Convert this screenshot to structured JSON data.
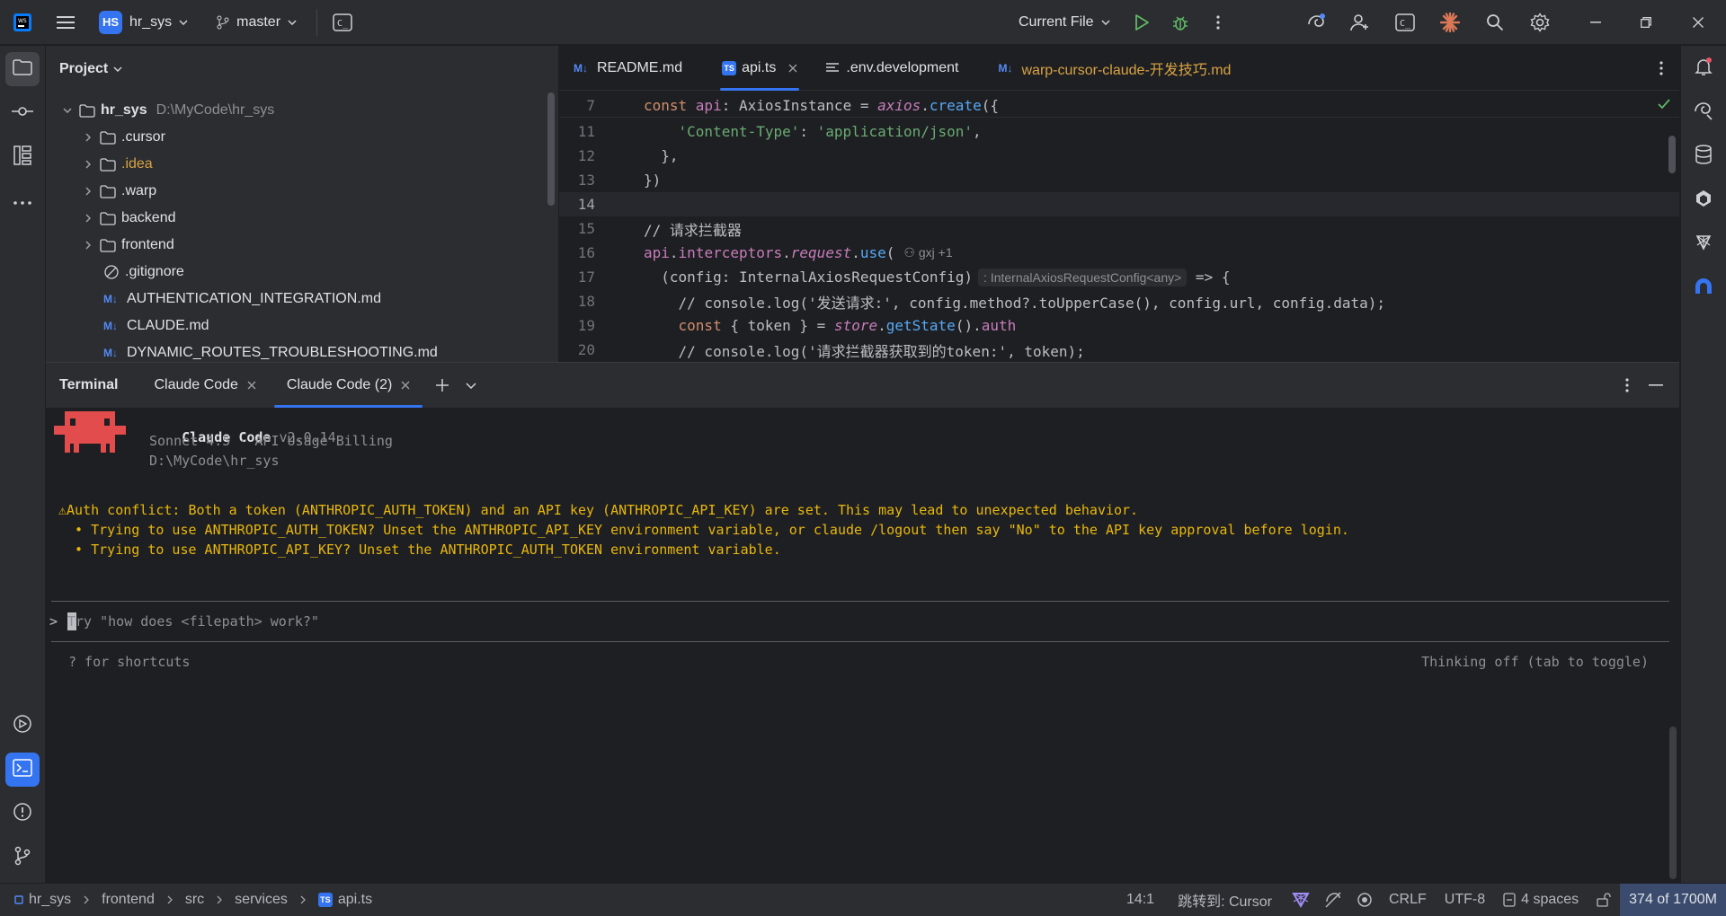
{
  "titlebar": {
    "project_badge": "HS",
    "project_name": "hr_sys",
    "branch": "master",
    "run_config": "Current File",
    "icons": [
      "app-logo-icon",
      "main-menu-icon",
      "branch-icon",
      "terminal-tool-icon",
      "run-icon",
      "debug-icon",
      "more-vert-icon",
      "ai-assistant-icon",
      "add-user-icon",
      "code-with-me-icon",
      "claude-icon",
      "search-icon",
      "settings-icon",
      "minimize-icon",
      "restore-icon",
      "close-icon"
    ]
  },
  "project_panel": {
    "title": "Project",
    "root": {
      "name": "hr_sys",
      "path": "D:\\MyCode\\hr_sys"
    },
    "items": [
      {
        "label": ".cursor",
        "type": "folder"
      },
      {
        "label": ".idea",
        "type": "folder",
        "color": "#d9a343"
      },
      {
        "label": ".warp",
        "type": "folder"
      },
      {
        "label": "backend",
        "type": "folder"
      },
      {
        "label": "frontend",
        "type": "folder"
      },
      {
        "label": ".gitignore",
        "type": "ignore"
      },
      {
        "label": "AUTHENTICATION_INTEGRATION.md",
        "type": "md"
      },
      {
        "label": "CLAUDE.md",
        "type": "md"
      },
      {
        "label": "DYNAMIC_ROUTES_TROUBLESHOOTING.md",
        "type": "md"
      }
    ]
  },
  "editor": {
    "tabs": [
      {
        "label": "README.md",
        "type": "md"
      },
      {
        "label": "api.ts",
        "type": "ts",
        "active": true
      },
      {
        "label": ".env.development",
        "type": "env"
      },
      {
        "label": "warp-cursor-claude-开发技巧.md",
        "type": "md",
        "color": "#d9a343"
      }
    ],
    "line_numbers": [
      "7",
      "11",
      "12",
      "13",
      "14",
      "15",
      "16",
      "17",
      "18",
      "19",
      "20"
    ],
    "code": {
      "l7_a": "const ",
      "l7_b": "api",
      "l7_c": ": AxiosInstance = ",
      "l7_d": "axios",
      "l7_e": ".",
      "l7_f": "create",
      "l7_g": "({",
      "l11_a": "    ",
      "l11_b": "'Content-Type'",
      "l11_c": ": ",
      "l11_d": "'application/json'",
      "l11_e": ",",
      "l12": "  },",
      "l13": "})",
      "l15": "// 请求拦截器",
      "l16_a": "api",
      "l16_b": ".",
      "l16_c": "interceptors",
      "l16_d": ".",
      "l16_e": "request",
      "l16_f": ".",
      "l16_g": "use",
      "l16_h": "(",
      "l16_author": "gxj +1",
      "l17_a": "  (config: InternalAxiosRequestConfig)",
      "l17_hint": ": InternalAxiosRequestConfig<any>",
      "l17_b": " => {",
      "l18": "    // console.log('发送请求:', config.method?.toUpperCase(), config.url, config.data);",
      "l19_a": "    ",
      "l19_b": "const",
      "l19_c": " { token } = ",
      "l19_d": "store",
      "l19_e": ".",
      "l19_f": "getState",
      "l19_g": "().",
      "l19_h": "auth",
      "l20": "    // console.log('请求拦截器获取到的token:', token);"
    }
  },
  "terminal": {
    "tabs": [
      {
        "label": "Terminal"
      },
      {
        "label": "Claude Code",
        "closable": true
      },
      {
        "label": "Claude Code (2)",
        "closable": true,
        "active": true
      }
    ],
    "header": {
      "name": "Claude Code",
      "version": "v2.0.14",
      "model": "Sonnet 4.5 · API Usage Billing",
      "cwd": "D:\\MyCode\\hr_sys"
    },
    "warning_title": "⚠Auth conflict: Both a token (ANTHROPIC_AUTH_TOKEN) and an API key (ANTHROPIC_API_KEY) are set. This may lead to unexpected behavior.",
    "warning_bullets": [
      "  • Trying to use ANTHROPIC_AUTH_TOKEN? Unset the ANTHROPIC_API_KEY environment variable, or claude /logout then say \"No\" to the API key approval before login.",
      "  • Trying to use ANTHROPIC_API_KEY? Unset the ANTHROPIC_AUTH_TOKEN environment variable."
    ],
    "prompt_symbol": ">",
    "prompt_placeholder": "Try \"how does <filepath> work?\"",
    "shortcuts_hint": "? for shortcuts",
    "thinking_hint": "Thinking off (tab to toggle)"
  },
  "statusbar": {
    "breadcrumb": [
      "hr_sys",
      "frontend",
      "src",
      "services",
      "api.ts"
    ],
    "position": "14:1",
    "goto": "跳转到: Cursor",
    "line_sep": "CRLF",
    "encoding": "UTF-8",
    "indent": "4 spaces",
    "memory": "374 of 1700M"
  },
  "colors": {
    "accent": "#3574f0",
    "warning": "#e8b70d",
    "claude_logo": "#e34c4c"
  }
}
